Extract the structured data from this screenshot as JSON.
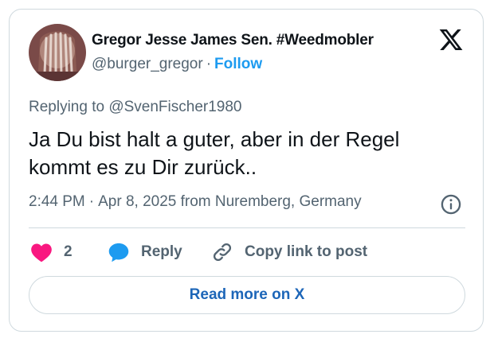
{
  "author": {
    "display_name": "Gregor Jesse James Sen. #Weedmobler",
    "handle": "@burger_gregor",
    "separator": "·",
    "follow_label": "Follow"
  },
  "tweet": {
    "replying_to": "Replying to @SvenFischer1980",
    "text": "Ja Du bist halt a guter, aber in der Regel kommt es zu Dir zurück..",
    "time": "2:44 PM",
    "meta_separator": "·",
    "date_location": "Apr 8, 2025 from Nuremberg, Germany"
  },
  "actions": {
    "like_count": "2",
    "reply_label": "Reply",
    "copy_label": "Copy link to post"
  },
  "footer": {
    "read_more_label": "Read more on X"
  },
  "icons": {
    "logo": "x-logo-icon",
    "info": "info-icon",
    "like": "heart-icon",
    "reply": "speech-bubble-icon",
    "copy": "link-icon"
  },
  "colors": {
    "accent": "#1d9bf0",
    "like": "#f91880",
    "reply_icon": "#1d9bf0",
    "secondary_text": "#536471",
    "border": "#cfd9de"
  }
}
